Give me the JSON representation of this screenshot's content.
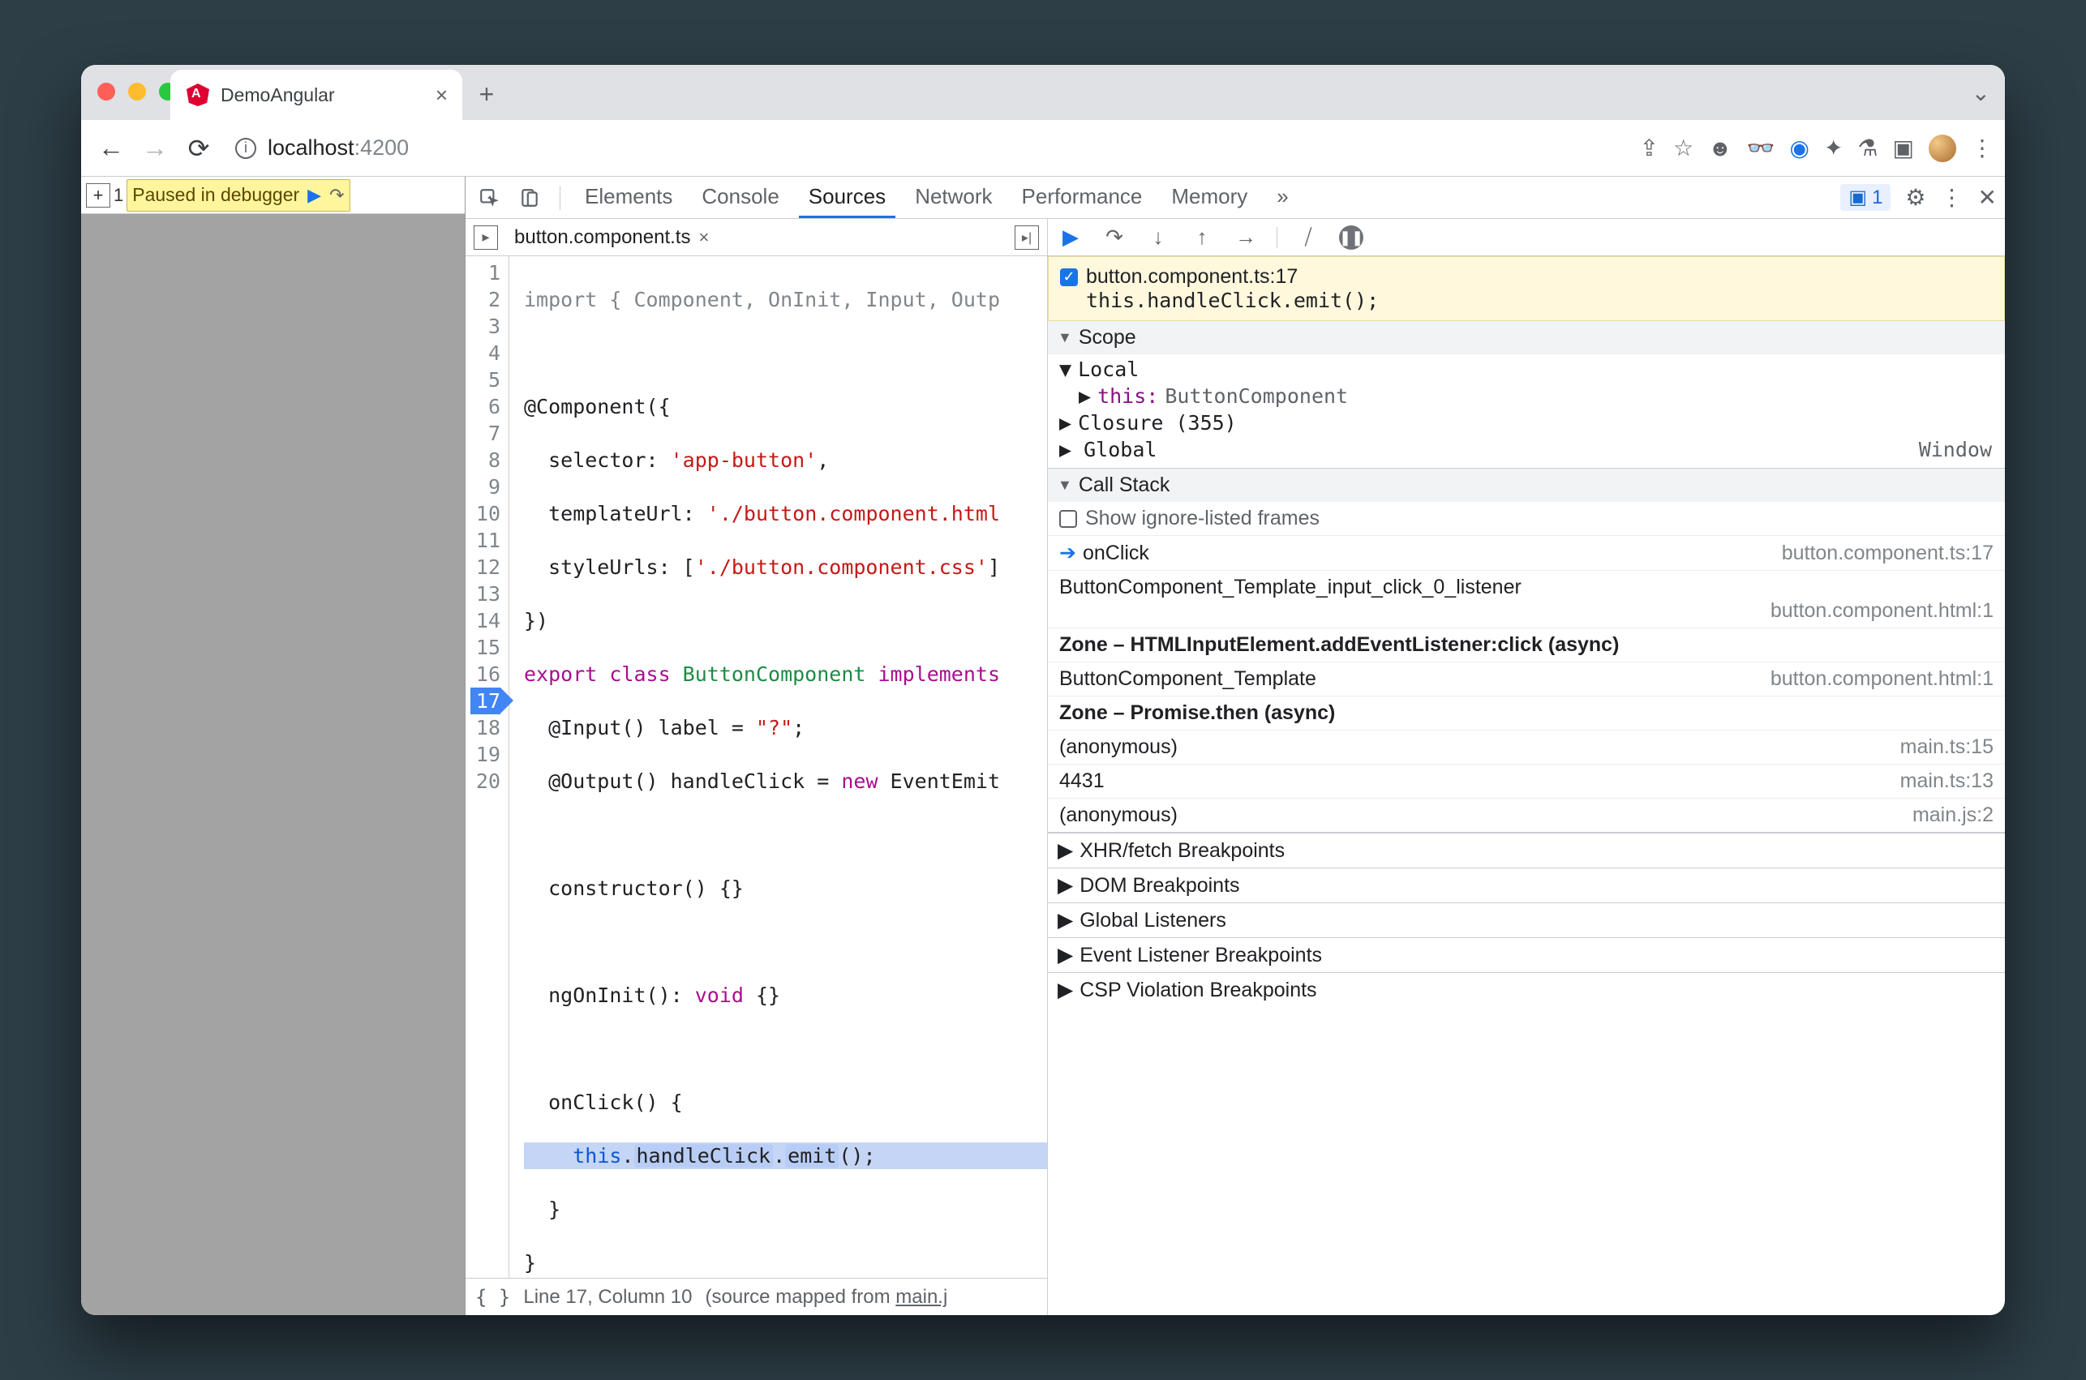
{
  "browser_tab": {
    "title": "DemoAngular"
  },
  "addressbar": {
    "host": "localhost",
    "port": ":4200"
  },
  "page": {
    "pause_text": "Paused in debugger",
    "expand_count": "1"
  },
  "devtools_tabs": {
    "elements": "Elements",
    "console": "Console",
    "sources": "Sources",
    "network": "Network",
    "performance": "Performance",
    "memory": "Memory",
    "more": "»",
    "issues_count": "1"
  },
  "source": {
    "filename": "button.component.ts",
    "line_numbers": [
      "1",
      "2",
      "3",
      "4",
      "5",
      "6",
      "7",
      "8",
      "9",
      "10",
      "11",
      "12",
      "13",
      "14",
      "15",
      "16",
      "17",
      "18",
      "19",
      "20"
    ],
    "bp_line": "17",
    "line01_a": "import { Component, OnInit, Input, Outp",
    "line03": "@Component({",
    "line04_a": "  selector: ",
    "line04_b": "'app-button'",
    "line04_c": ",",
    "line05_a": "  templateUrl: ",
    "line05_b": "'./button.component.html",
    "line05_c": "",
    "line06_a": "  styleUrls: [",
    "line06_b": "'./button.component.css'",
    "line06_c": "]",
    "line07": "})",
    "line08_a": "export ",
    "line08_b": "class ",
    "line08_c": "ButtonComponent",
    "line08_d": " implements",
    "line09_a": "  @Input() label = ",
    "line09_b": "\"?\"",
    "line09_c": ";",
    "line10_a": "  @Output() handleClick = ",
    "line10_b": "new",
    "line10_c": " EventEmit",
    "line12": "  constructor() {}",
    "line14_a": "  ngOnInit(): ",
    "line14_b": "void",
    "line14_c": " {}",
    "line16": "  onClick() {",
    "line17_a": "    ",
    "line17_this": "this",
    "line17_dot1": ".",
    "line17_hc": "handleClick",
    "line17_dot2": ".",
    "line17_emit": "emit",
    "line17_end": "();",
    "line18": "  }",
    "line19": "}"
  },
  "statusbar": {
    "pretty": "{ }",
    "pos": "Line 17, Column 10",
    "mapped_label": "(source mapped from ",
    "mapped_link": "main.j"
  },
  "breakpoint": {
    "file": "button.component.ts:17",
    "code": "this.handleClick.emit();"
  },
  "scope": {
    "title": "Scope",
    "local": "Local",
    "this_label": "this:",
    "this_val": "ButtonComponent",
    "closure": "Closure (355)",
    "global": "Global",
    "window": "Window"
  },
  "callstack": {
    "title": "Call Stack",
    "show_ignore": "Show ignore-listed frames",
    "f0_fn": "onClick",
    "f0_loc": "button.component.ts:17",
    "f1_fn": "ButtonComponent_Template_input_click_0_listener",
    "f1_loc": "button.component.html:1",
    "z1": "Zone – HTMLInputElement.addEventListener:click (async)",
    "f2_fn": "ButtonComponent_Template",
    "f2_loc": "button.component.html:1",
    "z2": "Zone – Promise.then (async)",
    "f3_fn": "(anonymous)",
    "f3_loc": "main.ts:15",
    "f4_fn": "4431",
    "f4_loc": "main.ts:13",
    "f5_fn": "(anonymous)",
    "f5_loc": "main.js:2"
  },
  "panels": {
    "xhr": "XHR/fetch Breakpoints",
    "dom": "DOM Breakpoints",
    "gl": "Global Listeners",
    "el": "Event Listener Breakpoints",
    "csp": "CSP Violation Breakpoints"
  }
}
